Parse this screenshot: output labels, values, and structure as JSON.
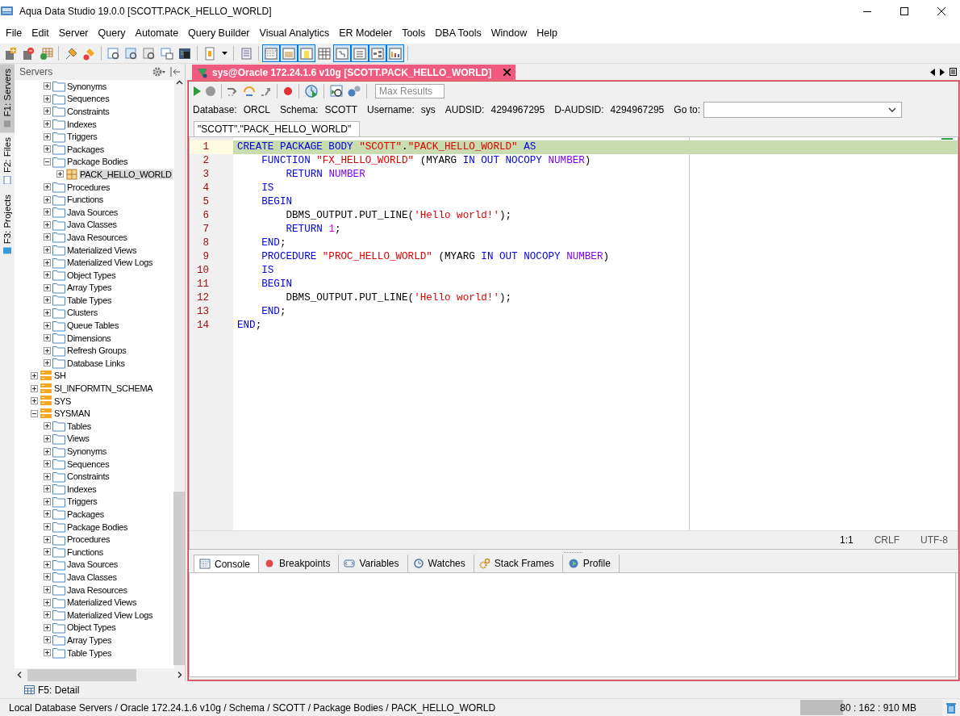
{
  "window": {
    "title": "Aqua Data Studio 19.0.0  [SCOTT.PACK_HELLO_WORLD]"
  },
  "menu": [
    "File",
    "Edit",
    "Server",
    "Query",
    "Automate",
    "Query Builder",
    "Visual Analytics",
    "ER Modeler",
    "Tools",
    "DBA Tools",
    "Window",
    "Help"
  ],
  "toolbar": [
    {
      "kind": "button"
    },
    {
      "kind": "button"
    },
    {
      "kind": "button"
    },
    {
      "kind": "separator"
    },
    {
      "kind": "button"
    },
    {
      "kind": "button"
    },
    {
      "kind": "separator"
    },
    {
      "kind": "button"
    },
    {
      "kind": "button"
    },
    {
      "kind": "button"
    },
    {
      "kind": "button"
    },
    {
      "kind": "button"
    },
    {
      "kind": "separator"
    },
    {
      "kind": "button"
    },
    {
      "kind": "dropdown"
    },
    {
      "kind": "separator"
    },
    {
      "kind": "button"
    },
    {
      "kind": "separator"
    },
    {
      "kind": "toggle",
      "on": true
    },
    {
      "kind": "toggle",
      "on": true
    },
    {
      "kind": "toggle",
      "on": true
    },
    {
      "kind": "toggle",
      "on": false
    },
    {
      "kind": "toggle",
      "on": true
    },
    {
      "kind": "toggle",
      "on": true
    },
    {
      "kind": "toggle",
      "on": true
    },
    {
      "kind": "toggle",
      "on": true
    },
    {
      "kind": "separator"
    }
  ],
  "side_tabs": [
    {
      "label": "F1: Servers",
      "selected": true
    },
    {
      "label": "F2: Files",
      "selected": false
    },
    {
      "label": "F3: Projects",
      "selected": false
    }
  ],
  "servers_panel": {
    "title": "Servers",
    "tree": {
      "open_branch": [
        {
          "label": "Synonyms",
          "kind": "folder",
          "expanded": false,
          "selected": false
        },
        {
          "label": "Sequences",
          "kind": "folder",
          "expanded": false,
          "selected": false
        },
        {
          "label": "Constraints",
          "kind": "folder",
          "expanded": false,
          "selected": false
        },
        {
          "label": "Indexes",
          "kind": "folder",
          "expanded": false,
          "selected": false
        },
        {
          "label": "Triggers",
          "kind": "folder",
          "expanded": false,
          "selected": false
        },
        {
          "label": "Packages",
          "kind": "folder",
          "expanded": false,
          "selected": false
        },
        {
          "label": "Package Bodies",
          "kind": "folder",
          "expanded": true,
          "selected": false,
          "children": [
            {
              "label": "PACK_HELLO_WORLD",
              "kind": "package",
              "expanded": false,
              "selected": true
            }
          ]
        },
        {
          "label": "Procedures",
          "kind": "folder",
          "expanded": false,
          "selected": false
        },
        {
          "label": "Functions",
          "kind": "folder",
          "expanded": false,
          "selected": false
        },
        {
          "label": "Java Sources",
          "kind": "folder",
          "expanded": false,
          "selected": false
        },
        {
          "label": "Java Classes",
          "kind": "folder",
          "expanded": false,
          "selected": false
        },
        {
          "label": "Java Resources",
          "kind": "folder",
          "expanded": false,
          "selected": false
        },
        {
          "label": "Materialized Views",
          "kind": "folder",
          "expanded": false,
          "selected": false
        },
        {
          "label": "Materialized View Logs",
          "kind": "folder",
          "expanded": false,
          "selected": false
        },
        {
          "label": "Object Types",
          "kind": "folder",
          "expanded": false,
          "selected": false
        },
        {
          "label": "Array Types",
          "kind": "folder",
          "expanded": false,
          "selected": false
        },
        {
          "label": "Table Types",
          "kind": "folder",
          "expanded": false,
          "selected": false
        },
        {
          "label": "Clusters",
          "kind": "folder",
          "expanded": false,
          "selected": false
        },
        {
          "label": "Queue Tables",
          "kind": "folder",
          "expanded": false,
          "selected": false
        },
        {
          "label": "Dimensions",
          "kind": "folder",
          "expanded": false,
          "selected": false
        },
        {
          "label": "Refresh Groups",
          "kind": "folder",
          "expanded": false,
          "selected": false
        },
        {
          "label": "Database Links",
          "kind": "folder",
          "expanded": false,
          "selected": false
        }
      ],
      "schemas": [
        {
          "label": "SH",
          "kind": "schema",
          "expanded": false,
          "selected": false
        },
        {
          "label": "SI_INFORMTN_SCHEMA",
          "kind": "schema",
          "expanded": false,
          "selected": false
        },
        {
          "label": "SYS",
          "kind": "schema",
          "expanded": false,
          "selected": false
        },
        {
          "label": "SYSMAN",
          "kind": "schema",
          "expanded": true,
          "selected": false,
          "children": [
            {
              "label": "Tables",
              "kind": "folder",
              "expanded": false,
              "selected": false
            },
            {
              "label": "Views",
              "kind": "folder",
              "expanded": false,
              "selected": false
            },
            {
              "label": "Synonyms",
              "kind": "folder",
              "expanded": false,
              "selected": false
            },
            {
              "label": "Sequences",
              "kind": "folder",
              "expanded": false,
              "selected": false
            },
            {
              "label": "Constraints",
              "kind": "folder",
              "expanded": false,
              "selected": false
            },
            {
              "label": "Indexes",
              "kind": "folder",
              "expanded": false,
              "selected": false
            },
            {
              "label": "Triggers",
              "kind": "folder",
              "expanded": false,
              "selected": false
            },
            {
              "label": "Packages",
              "kind": "folder",
              "expanded": false,
              "selected": false
            },
            {
              "label": "Package Bodies",
              "kind": "folder",
              "expanded": false,
              "selected": false
            },
            {
              "label": "Procedures",
              "kind": "folder",
              "expanded": false,
              "selected": false
            },
            {
              "label": "Functions",
              "kind": "folder",
              "expanded": false,
              "selected": false
            },
            {
              "label": "Java Sources",
              "kind": "folder",
              "expanded": false,
              "selected": false
            },
            {
              "label": "Java Classes",
              "kind": "folder",
              "expanded": false,
              "selected": false
            },
            {
              "label": "Java Resources",
              "kind": "folder",
              "expanded": false,
              "selected": false
            },
            {
              "label": "Materialized Views",
              "kind": "folder",
              "expanded": false,
              "selected": false
            },
            {
              "label": "Materialized View Logs",
              "kind": "folder",
              "expanded": false,
              "selected": false
            },
            {
              "label": "Object Types",
              "kind": "folder",
              "expanded": false,
              "selected": false
            },
            {
              "label": "Array Types",
              "kind": "folder",
              "expanded": false,
              "selected": false
            },
            {
              "label": "Table Types",
              "kind": "folder",
              "expanded": false,
              "selected": false
            }
          ]
        }
      ]
    }
  },
  "editor_tabs": [
    {
      "label": "sys@Oracle 172.24.1.6 v10g [SCOTT.PACK_HELLO_WORLD]",
      "selected": true
    }
  ],
  "max_results": {
    "placeholder": "Max Results"
  },
  "connection_info": [
    {
      "label": "Database:",
      "value": "ORCL"
    },
    {
      "label": "Schema:",
      "value": "SCOTT"
    },
    {
      "label": "Username:",
      "value": "sys"
    },
    {
      "label": "AUDSID:",
      "value": "4294967295"
    },
    {
      "label": "D-AUDSID:",
      "value": "4294967295"
    }
  ],
  "goto": {
    "label": "Go to:"
  },
  "document_tabs": [
    {
      "label": "\"SCOTT\".\"PACK_HELLO_WORLD\"",
      "selected": true
    }
  ],
  "code": {
    "lines": [
      {
        "number": "1",
        "current": true,
        "tokens": [
          {
            "kind": "kw",
            "text": "CREATE PACKAGE BODY "
          },
          {
            "kind": "str",
            "text": "\"SCOTT\""
          },
          {
            "kind": "text",
            "text": "."
          },
          {
            "kind": "str",
            "text": "\"PACK_HELLO_WORLD\""
          },
          {
            "kind": "kw",
            "text": " AS"
          }
        ]
      },
      {
        "number": "2",
        "current": false,
        "tokens": [
          {
            "kind": "kw",
            "text": "    FUNCTION "
          },
          {
            "kind": "str",
            "text": "\"FX_HELLO_WORLD\""
          },
          {
            "kind": "text",
            "text": " (MYARG "
          },
          {
            "kind": "kw",
            "text": "IN OUT NOCOPY "
          },
          {
            "kind": "type",
            "text": "NUMBER"
          },
          {
            "kind": "text",
            "text": ")"
          }
        ]
      },
      {
        "number": "3",
        "current": false,
        "tokens": [
          {
            "kind": "kw",
            "text": "        RETURN "
          },
          {
            "kind": "type",
            "text": "NUMBER"
          }
        ]
      },
      {
        "number": "4",
        "current": false,
        "tokens": [
          {
            "kind": "kw",
            "text": "    IS"
          }
        ]
      },
      {
        "number": "5",
        "current": false,
        "tokens": [
          {
            "kind": "kw",
            "text": "    BEGIN"
          }
        ]
      },
      {
        "number": "6",
        "current": false,
        "tokens": [
          {
            "kind": "text",
            "text": "        DBMS_OUTPUT.PUT_LINE("
          },
          {
            "kind": "str",
            "text": "'Hello world!'"
          },
          {
            "kind": "text",
            "text": ");"
          }
        ]
      },
      {
        "number": "7",
        "current": false,
        "tokens": [
          {
            "kind": "kw",
            "text": "        RETURN "
          },
          {
            "kind": "num",
            "text": "1"
          },
          {
            "kind": "text",
            "text": ";"
          }
        ]
      },
      {
        "number": "8",
        "current": false,
        "tokens": [
          {
            "kind": "kw",
            "text": "    END"
          },
          {
            "kind": "text",
            "text": ";"
          }
        ]
      },
      {
        "number": "9",
        "current": false,
        "tokens": [
          {
            "kind": "kw",
            "text": "    PROCEDURE "
          },
          {
            "kind": "str",
            "text": "\"PROC_HELLO_WORLD\""
          },
          {
            "kind": "text",
            "text": " (MYARG "
          },
          {
            "kind": "kw",
            "text": "IN OUT NOCOPY "
          },
          {
            "kind": "type",
            "text": "NUMBER"
          },
          {
            "kind": "text",
            "text": ")"
          }
        ]
      },
      {
        "number": "10",
        "current": false,
        "tokens": [
          {
            "kind": "kw",
            "text": "    IS"
          }
        ]
      },
      {
        "number": "11",
        "current": false,
        "tokens": [
          {
            "kind": "kw",
            "text": "    BEGIN"
          }
        ]
      },
      {
        "number": "12",
        "current": false,
        "tokens": [
          {
            "kind": "text",
            "text": "        DBMS_OUTPUT.PUT_LINE("
          },
          {
            "kind": "str",
            "text": "'Hello world!'"
          },
          {
            "kind": "text",
            "text": ");"
          }
        ]
      },
      {
        "number": "13",
        "current": false,
        "tokens": [
          {
            "kind": "kw",
            "text": "    END"
          },
          {
            "kind": "text",
            "text": ";"
          }
        ]
      },
      {
        "number": "14",
        "current": false,
        "tokens": [
          {
            "kind": "kw",
            "text": "END"
          },
          {
            "kind": "text",
            "text": ";"
          }
        ]
      }
    ]
  },
  "editor_status": [
    "1:1",
    "CRLF",
    "UTF-8"
  ],
  "bottom_tabs": [
    {
      "label": "Console",
      "selected": true
    },
    {
      "label": "Breakpoints",
      "selected": false
    },
    {
      "label": "Variables",
      "selected": false
    },
    {
      "label": "Watches",
      "selected": false
    },
    {
      "label": "Stack Frames",
      "selected": false
    },
    {
      "label": "Profile",
      "selected": false
    }
  ],
  "detail_tab": {
    "label": "F5: Detail"
  },
  "status_bar": {
    "path": "Local Database Servers / Oracle 172.24.1.6 v10g / Schema / SCOTT / Package Bodies / PACK_HELLO_WORLD",
    "memory": {
      "text": "80 : 162 : 910 MB",
      "level": 0.3
    }
  }
}
